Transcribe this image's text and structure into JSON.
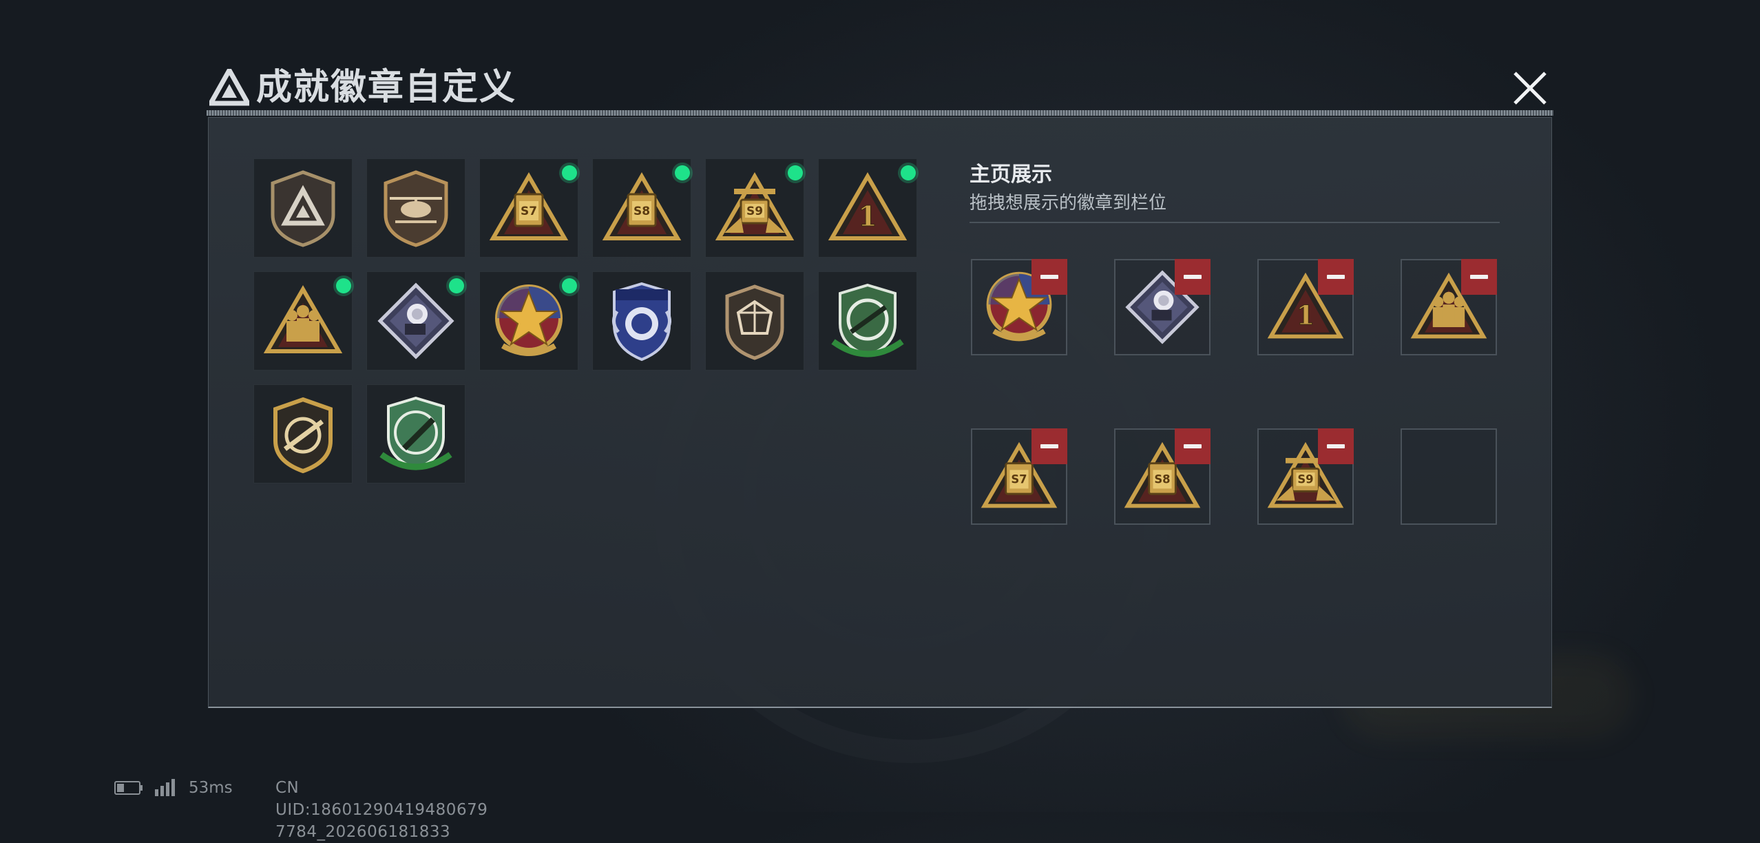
{
  "dialog": {
    "title": "成就徽章自定义",
    "close_label": "Close"
  },
  "badges": [
    {
      "name": "shield-triangle",
      "new": false
    },
    {
      "name": "helicopter-shield",
      "new": false
    },
    {
      "name": "season-s7",
      "new": true,
      "label": "S7"
    },
    {
      "name": "season-s8",
      "new": true,
      "label": "S8"
    },
    {
      "name": "season-s9",
      "new": true,
      "label": "S9"
    },
    {
      "name": "rank-one",
      "new": true,
      "label": "1"
    },
    {
      "name": "squad-triangle",
      "new": true
    },
    {
      "name": "rose-diamond",
      "new": true
    },
    {
      "name": "star-medal",
      "new": true
    },
    {
      "name": "blue-wing-shield",
      "new": false
    },
    {
      "name": "gem-shield",
      "new": false
    },
    {
      "name": "green-rifle-scope",
      "new": false
    },
    {
      "name": "gold-rifle-shield",
      "new": false
    },
    {
      "name": "green-knife-scope",
      "new": false
    }
  ],
  "display": {
    "title": "主页展示",
    "subtitle": "拖拽想展示的徽章到栏位",
    "slots": [
      {
        "badge": "star-medal",
        "removable": true
      },
      {
        "badge": "rose-diamond",
        "removable": true
      },
      {
        "badge": "rank-one",
        "removable": true
      },
      {
        "badge": "squad-triangle",
        "removable": true
      },
      {
        "badge": "season-s7",
        "removable": true
      },
      {
        "badge": "season-s8",
        "removable": true
      },
      {
        "badge": "season-s9",
        "removable": true
      },
      {
        "badge": "",
        "removable": false
      }
    ]
  },
  "status": {
    "ping": "53ms",
    "uid": "CN UID:18601290419480679​7784_202606181833"
  },
  "colors": {
    "accent_green": "#1ee28a",
    "remove_red": "#9b2c30",
    "gold": "#c9a04a"
  }
}
